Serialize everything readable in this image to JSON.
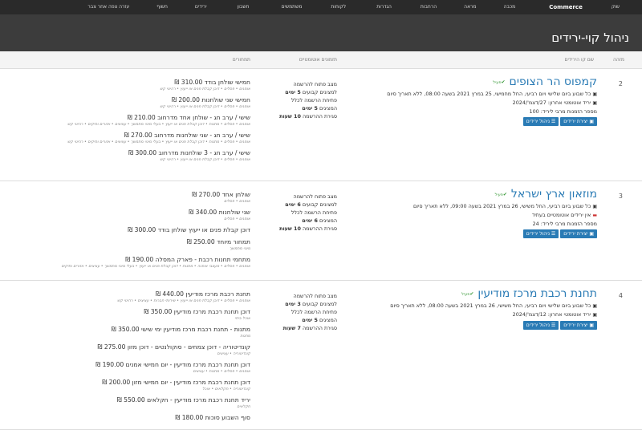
{
  "nav": {
    "items": [
      "שוק",
      "Commerce",
      "מכבה",
      "מראה",
      "הרחבות",
      "הגדרות",
      "לקוחות",
      "משתמשים",
      "חשבון",
      "ירידים",
      "חשוף",
      "עזרה צפה אחר צבר"
    ]
  },
  "page": {
    "title": "ניהול קוי-ירידים"
  },
  "columns": {
    "id": "מזהה",
    "name": "שם קו הירידים",
    "schedule": "תזמונים אוטומטיים",
    "pricing": "תמחורים"
  },
  "rows": [
    {
      "num": "2",
      "name": "קמפוס הר הצופים",
      "active_label": "פעיל",
      "lines": [
        {
          "icon": "calendar",
          "text": "כל שבוע ביום שלישי ויום רביעי, החל מחמישי, 25 במרץ 2021 בשעה 08:00, ללא תאריך סיום"
        },
        {
          "icon": "calendar",
          "text": "יריד אוטומטי אחרון: 27/דצמ'/2024"
        },
        {
          "icon": "",
          "text": "מספר הזמנות מרבי ליריד: 100"
        }
      ],
      "buttons": [
        "יצירת ירידים",
        "ניהול ירידים"
      ],
      "schedule": [
        {
          "text": "מצב פתוח להרשמה",
          "bold": ""
        },
        {
          "text": "למציגים קבועים ",
          "bold": "5 ימים"
        },
        {
          "text": "פתיחת הרשמה לכלל",
          "bold": ""
        },
        {
          "text": "המציגים ",
          "bold": "5 ימים"
        },
        {
          "text": "סגירת ההרשמה ",
          "bold": "10 שעות"
        }
      ],
      "prices": [
        {
          "title": "חמישי שולחן בודד 310.00 ₪",
          "sub": "אומנים • פסלים • דוכן קבלת פנים או ייעוץ • רהיטי קש"
        },
        {
          "title": "חמישי שני שולחנות 200.00 ₪",
          "sub": "אומנים • פסלים • דוכן קבלת פנים או ייעוץ • רהיטי קש"
        },
        {
          "title": "שישי / ערב חג - שולחן אחד מדרחוב 210.00 ₪",
          "sub": "אומנים • פסלים • מתנות • דוכן קבלת פנים או ייעוץ • בעלי מיגוי מתמשך • עציצים • אזורים ותיקים • רהיטי קש"
        },
        {
          "title": "שישי / ערב חג - שני שולחנות מדרחוב 270.00 ₪",
          "sub": "אומנים • פסלים • מתנות • דוכן קבלת פנים או ייעוץ • בעלי מיגוי מתמשך • עציצים • אזורים ותיקים • רהיטי קש"
        },
        {
          "title": "שישי / ערב חג - 3 שולחנות מדרחוב 300.00 ₪",
          "sub": "אומנים • פסלים • דוכן קבלת פנים או ייעוץ • רהיטי קש"
        }
      ]
    },
    {
      "num": "3",
      "name": "מוזאון ארץ ישראל",
      "active_label": "פעיל",
      "lines": [
        {
          "icon": "calendar",
          "text": "כל שבוע ביום רביעי, החל משישי, 26 במרץ 2021 בשעה 09:00, ללא תאריך סיום"
        },
        {
          "icon": "warning",
          "text": "אין ירידים אוטומטיים בעתיד"
        },
        {
          "icon": "",
          "text": "מספר הזמנות מרבי ליריד: 24"
        }
      ],
      "buttons": [
        "יצירת ירידים",
        "ניהול ירידים"
      ],
      "schedule": [
        {
          "text": "מצב פתוח להרשמה",
          "bold": ""
        },
        {
          "text": "למציגים קבועים ",
          "bold": "6 ימים"
        },
        {
          "text": "פתיחת הרשמה לכלל",
          "bold": ""
        },
        {
          "text": "המציגים ",
          "bold": "6 ימים"
        },
        {
          "text": "סגירת ההרשמה ",
          "bold": "10 שעות"
        }
      ],
      "prices": [
        {
          "title": "שולחן אחד 270.00 ₪",
          "sub": "אומנים • פסלים"
        },
        {
          "title": "שני שולחנות 340.00 ₪",
          "sub": "אומנים • פסלים"
        },
        {
          "title": "דוכן קבלת פנים או ייעוץ שולחן בודד 300.00 ₪",
          "sub": ""
        },
        {
          "title": "תמחור מיוחד 250.00 ₪",
          "sub": "מיגוי מתמשך"
        },
        {
          "title": "מתחמי תחנות רכבת - פארק המסלה 190.00 ₪",
          "sub": "אומנים • פסלים • מעצבי אופנה • מתנות • דוכן קבלת פנים או ייעוץ • בעלי מיגוי מתמשך • עציצים • אזורים ותיקים"
        }
      ]
    },
    {
      "num": "4",
      "name": "תחנת רכבת מרכז מודיעין",
      "active_label": "פעיל",
      "lines": [
        {
          "icon": "calendar",
          "text": "כל שבוע ביום שלישי ויום רביעי, החל משישי, 26 במרץ 2021 בשעה 08:00, ללא תאריך סיום"
        },
        {
          "icon": "calendar",
          "text": "יריד אוטומטי אחרון: 12/דצמ'/2024"
        }
      ],
      "buttons": [
        "יצירת ירידים",
        "ניהול ירידים"
      ],
      "schedule": [
        {
          "text": "מצב פתוח להרשמה",
          "bold": ""
        },
        {
          "text": "למציגים קבועים ",
          "bold": "3 ימים"
        },
        {
          "text": "פתיחת הרשמה לכלל",
          "bold": ""
        },
        {
          "text": "המציגים ",
          "bold": "5 ימים"
        },
        {
          "text": "סגירת ההרשמה ",
          "bold": "7 שעות"
        }
      ],
      "prices": [
        {
          "title": "תחנת רכבת מרכז מודיעין 440.00 ₪",
          "sub": "אומנים • פסלים • דוכן קבלת פנים או ייעוץ • שירותי חברות • עציצים • רהיטי קש"
        },
        {
          "title": "דוכן תחנת רכבת מרכז מודיעין 350.00 ₪",
          "sub": "אוכל ביתי"
        },
        {
          "title": "מתנות - תחנת רכבת מרכז מודיעין ימי שישי 350.00 ₪",
          "sub": "מתנות"
        },
        {
          "title": "קונדיטוריה - דוכן צמחים - סוקולנטים - דוכן מזון 275.00 ₪",
          "sub": "קונדיטוריה • עציצים"
        },
        {
          "title": "דוכן תחנת רכבת מרכז מודיעין - יום חמישי אמנים 190.00 ₪",
          "sub": "אומנים • פסלים • מתנות • עציצים"
        },
        {
          "title": "דוכן תחנת רכבת מרכז מודיעין - יום חמישי מזון 200.00 ₪",
          "sub": "קונדיטוריה • חקלאים • אוכל"
        },
        {
          "title": "יריד תחנת רכבת מרכז מודיעין - חקלאים 550.00 ₪",
          "sub": "חקלאים"
        },
        {
          "title": "סוף השבוע סוכות 180.00 ₪",
          "sub": ""
        }
      ]
    }
  ]
}
